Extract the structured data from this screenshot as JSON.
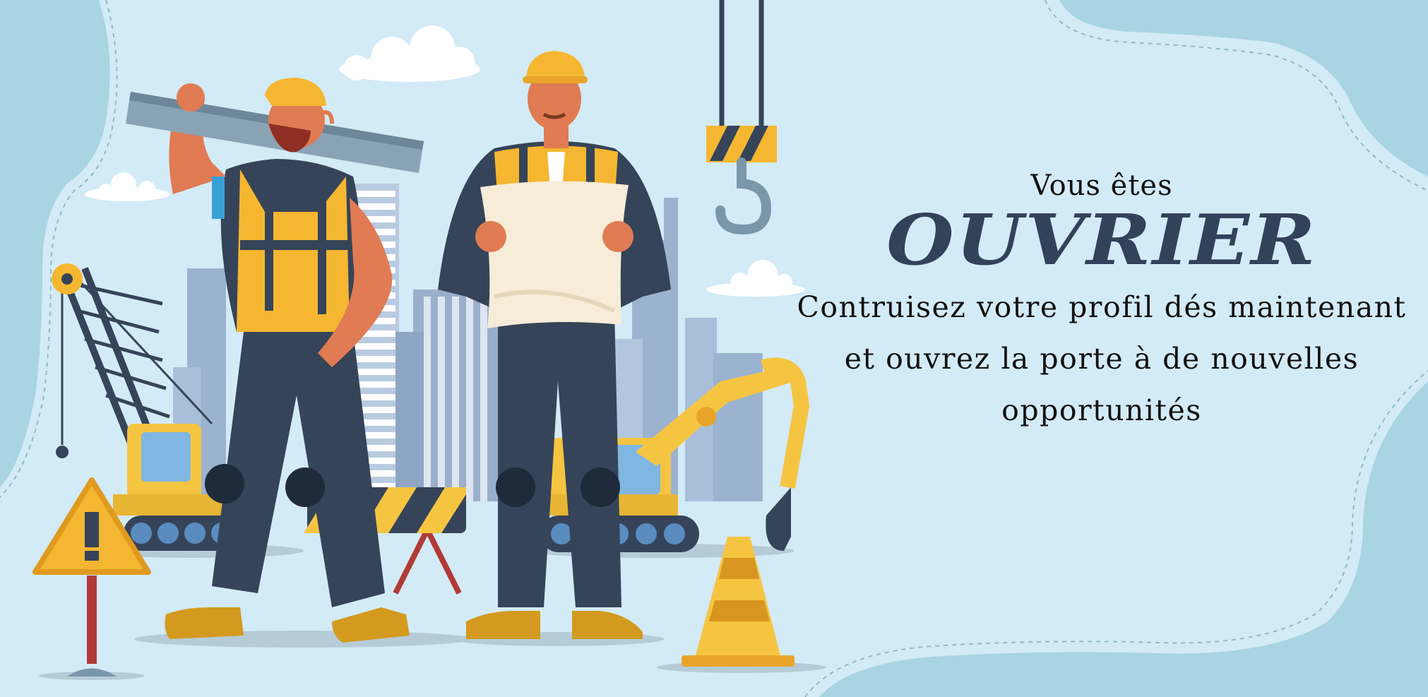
{
  "hero": {
    "intro": "Vous êtes",
    "headline": "OUVRIER",
    "body_line_1": "Contruisez votre profil dés maintenant",
    "body_line_2": "et ouvrez la porte à de nouvelles",
    "body_line_3": "opportunités"
  },
  "colors": {
    "background": "#d3ebf6",
    "blob": "#a9d4e2",
    "headline": "#33425b",
    "vest": "#f5b731",
    "pants": "#364459",
    "skin": "#e07b53"
  }
}
